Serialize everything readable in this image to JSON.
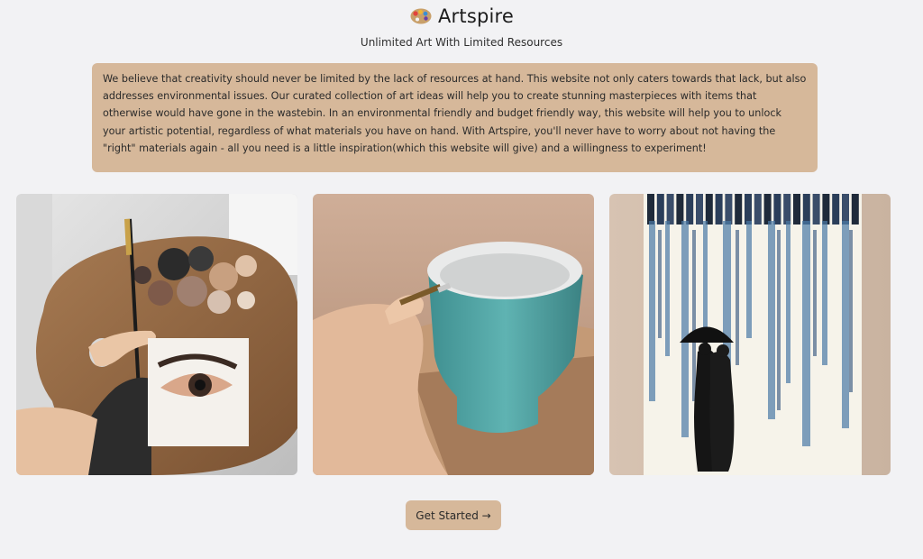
{
  "header": {
    "brand": "Artspire",
    "logo_icon": "paint-palette-icon",
    "tagline": "Unlimited Art With Limited Resources"
  },
  "about": {
    "text": "We believe that creativity should never be limited by the lack of resources at hand. This website not only caters towards that lack, but also addresses environmental issues. Our curated collection of art ideas will help you to create stunning masterpieces with items that otherwise would have gone in the wastebin. In an environmental friendly and budget friendly way, this website will help you to unlock your artistic potential, regardless of what materials you have on hand. With Artspire, you'll never have to worry about not having the \"right\" materials again - all you need is a little inspiration(which this website will give) and a willingness to experiment!"
  },
  "gallery": {
    "images": [
      "palette-with-eye-painting-image",
      "painting-teal-pot-image",
      "melted-crayon-rain-couple-image"
    ]
  },
  "cta": {
    "label": "Get Started →"
  },
  "colors": {
    "background": "#f2f2f4",
    "accent": "#d6b89a"
  }
}
